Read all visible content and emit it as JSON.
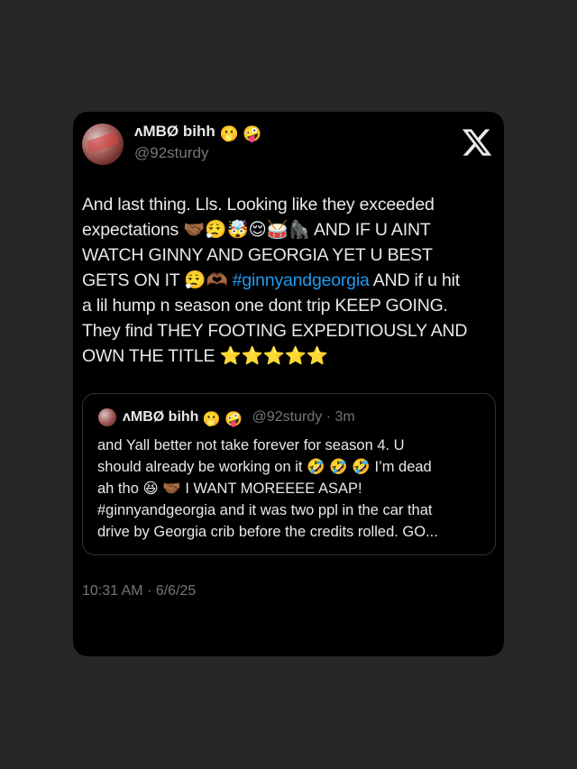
{
  "tweet": {
    "display_name": "ʌMBØ bihh",
    "name_emojis": "🫢 🤪",
    "handle": "@92sturdy",
    "platform_icon": "x-logo-icon",
    "text_lines": [
      [
        "And last thing. Lls. Looking like they exceeded"
      ],
      [
        "expectations 🤝🏾😮‍💨🤯😌🥁🦍 AND IF U AINT"
      ],
      [
        "WATCH GINNY AND GEORGIA YET U BEST"
      ],
      [
        "GETS ON IT 😮‍💨🫶🏾 "
      ],
      [
        "a lil hump n season one dont trip KEEP GOING."
      ],
      [
        "They find THEY FOOTING EXPEDITIOUSLY AND"
      ],
      [
        "OWN THE TITLE ⭐️⭐️⭐️⭐️⭐️"
      ]
    ],
    "line4_before": "GETS ON IT 😮‍💨🫶🏾 ",
    "hashtag": "#ginnyandgeorgia",
    "line4_after": " AND if u hit",
    "timestamp": "10:31 AM · 6/6/25"
  },
  "quoted_tweet": {
    "display_name": "ʌMBØ bihh",
    "name_emojis": "🫢 🤪",
    "handle_time": "@92sturdy · 3m",
    "text_lines": [
      "and Yall better not take forever for season 4. U",
      "should already be working on it 🤣 🤣 🤣  I’m dead",
      "ah tho 😆 🤝🏾  I WANT MOREEEE ASAP!",
      "#ginnyandgeorgia and it was two ppl in the car that",
      "drive by Georgia crib before the credits rolled. GO..."
    ]
  },
  "colors": {
    "background": "#272727",
    "card": "#000000",
    "text": "#e7e9ea",
    "muted": "#71767b",
    "hashtag": "#1d9bf0",
    "quote_border": "#2f3336"
  }
}
